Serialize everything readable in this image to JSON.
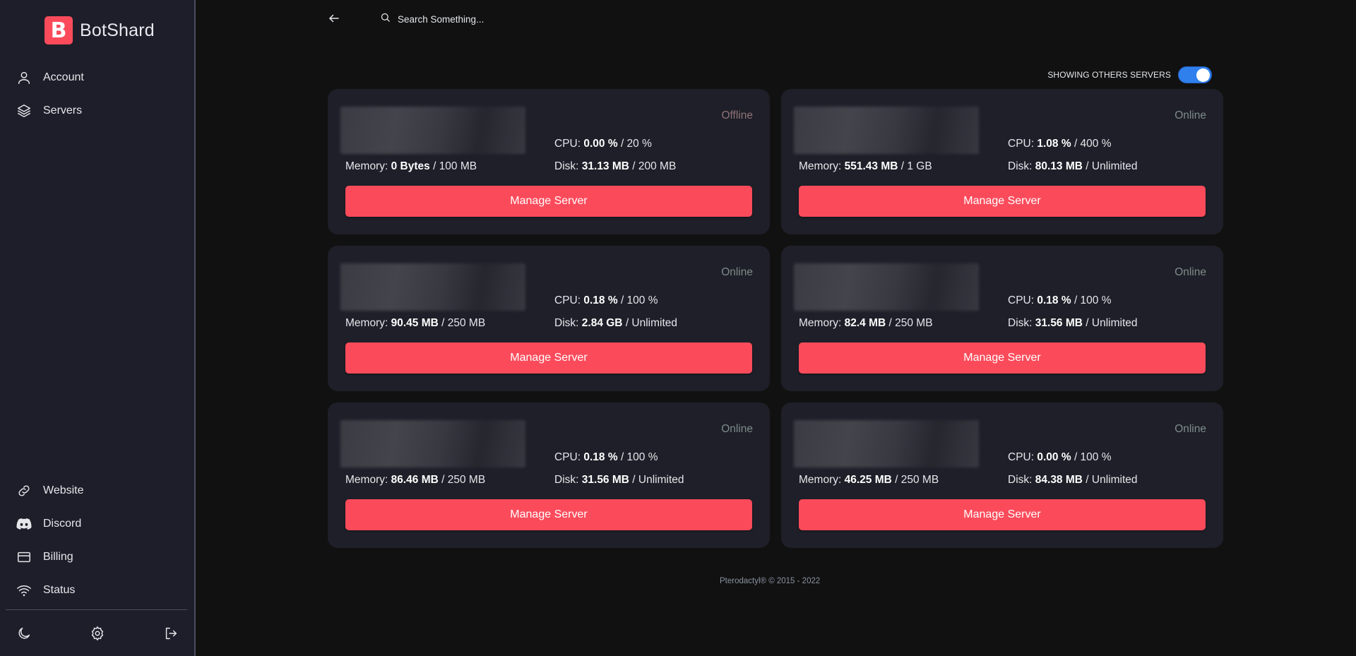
{
  "brand": {
    "logo_letter": "B",
    "name": "BotShard",
    "accent": "#fb4b5b"
  },
  "sidebar": {
    "top_items": [
      {
        "label": "Account",
        "icon": "user-icon"
      },
      {
        "label": "Servers",
        "icon": "layers-icon"
      }
    ],
    "bottom_items": [
      {
        "label": "Website",
        "icon": "link-icon"
      },
      {
        "label": "Discord",
        "icon": "discord-icon"
      },
      {
        "label": "Billing",
        "icon": "credit-card-icon"
      },
      {
        "label": "Status",
        "icon": "wifi-icon"
      }
    ],
    "footer_icons": [
      "moon-icon",
      "gear-icon",
      "logout-icon"
    ]
  },
  "topbar": {
    "back_icon": "arrow-left-icon",
    "search_placeholder": "Search Something..."
  },
  "toggle": {
    "label": "SHOWING OTHERS SERVERS",
    "enabled": true,
    "color": "#2f80ed"
  },
  "servers": [
    {
      "name": "[redacted]",
      "status": "Offline",
      "cpu_label": "CPU:",
      "cpu_used": "0.00 %",
      "cpu_limit": "/ 20 %",
      "mem_label": "Memory:",
      "mem_used": "0 Bytes",
      "mem_limit": "/ 100 MB",
      "disk_label": "Disk:",
      "disk_used": "31.13 MB",
      "disk_limit": "/ 200 MB",
      "button": "Manage Server"
    },
    {
      "name": "[redacted]",
      "status": "Online",
      "cpu_label": "CPU:",
      "cpu_used": "1.08 %",
      "cpu_limit": "/ 400 %",
      "mem_label": "Memory:",
      "mem_used": "551.43 MB",
      "mem_limit": "/ 1 GB",
      "disk_label": "Disk:",
      "disk_used": "80.13 MB",
      "disk_limit": "/ Unlimited",
      "button": "Manage Server"
    },
    {
      "name": "[redacted]",
      "status": "Online",
      "cpu_label": "CPU:",
      "cpu_used": "0.18 %",
      "cpu_limit": "/ 100 %",
      "mem_label": "Memory:",
      "mem_used": "90.45 MB",
      "mem_limit": "/ 250 MB",
      "disk_label": "Disk:",
      "disk_used": "2.84 GB",
      "disk_limit": "/ Unlimited",
      "button": "Manage Server"
    },
    {
      "name": "[redacted]",
      "status": "Online",
      "cpu_label": "CPU:",
      "cpu_used": "0.18 %",
      "cpu_limit": "/ 100 %",
      "mem_label": "Memory:",
      "mem_used": "82.4 MB",
      "mem_limit": "/ 250 MB",
      "disk_label": "Disk:",
      "disk_used": "31.56 MB",
      "disk_limit": "/ Unlimited",
      "button": "Manage Server"
    },
    {
      "name": "[redacted]",
      "status": "Online",
      "cpu_label": "CPU:",
      "cpu_used": "0.18 %",
      "cpu_limit": "/ 100 %",
      "mem_label": "Memory:",
      "mem_used": "86.46 MB",
      "mem_limit": "/ 250 MB",
      "disk_label": "Disk:",
      "disk_used": "31.56 MB",
      "disk_limit": "/ Unlimited",
      "button": "Manage Server"
    },
    {
      "name": "[redacted]",
      "status": "Online",
      "cpu_label": "CPU:",
      "cpu_used": "0.00 %",
      "cpu_limit": "/ 100 %",
      "mem_label": "Memory:",
      "mem_used": "46.25 MB",
      "mem_limit": "/ 250 MB",
      "disk_label": "Disk:",
      "disk_used": "84.38 MB",
      "disk_limit": "/ Unlimited",
      "button": "Manage Server"
    }
  ],
  "footer": {
    "text": "Pterodactyl® © 2015 - 2022"
  }
}
